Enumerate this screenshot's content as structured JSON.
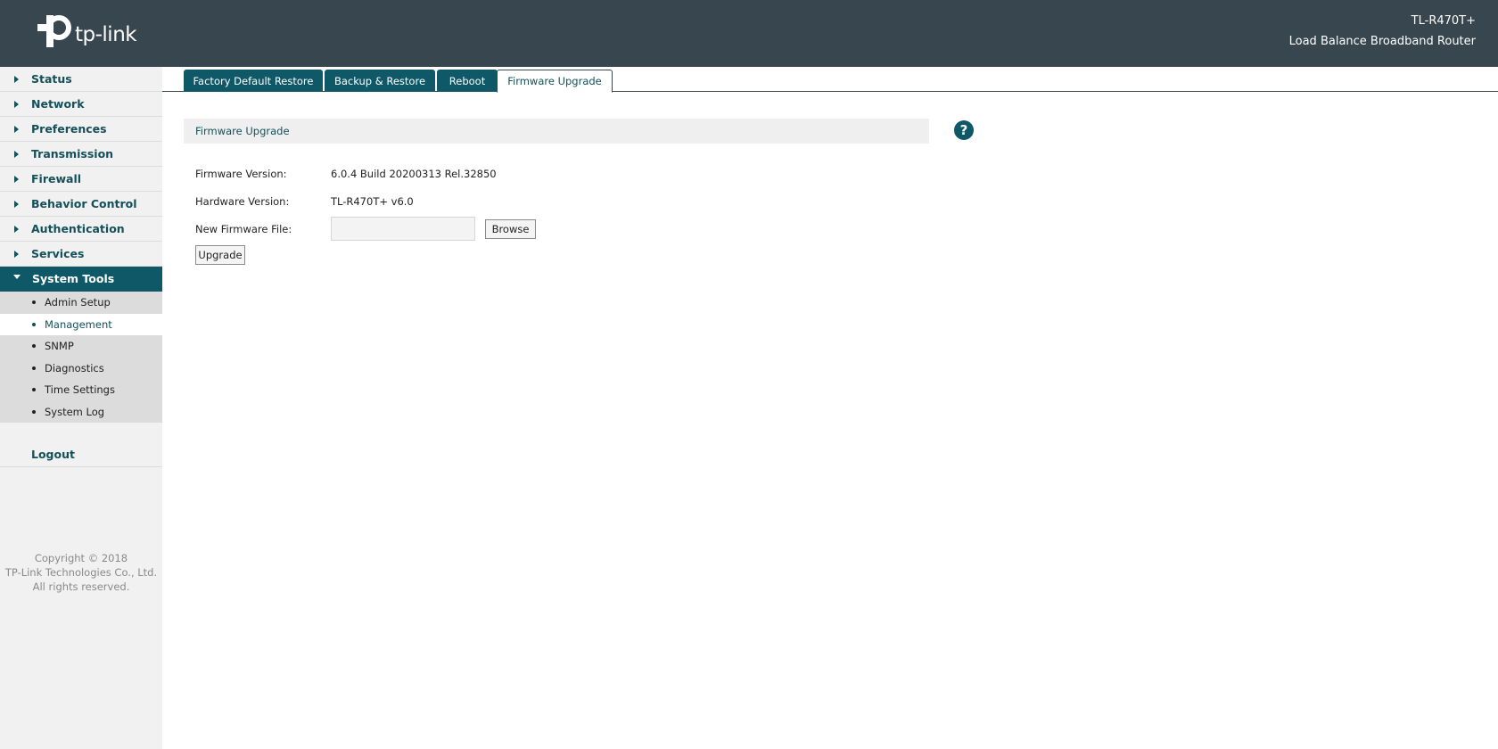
{
  "header": {
    "brand": "tp-link",
    "model": "TL-R470T+",
    "description": "Load Balance Broadband Router"
  },
  "sidebar": {
    "items": [
      {
        "label": "Status"
      },
      {
        "label": "Network"
      },
      {
        "label": "Preferences"
      },
      {
        "label": "Transmission"
      },
      {
        "label": "Firewall"
      },
      {
        "label": "Behavior Control"
      },
      {
        "label": "Authentication"
      },
      {
        "label": "Services"
      },
      {
        "label": "System Tools"
      }
    ],
    "subitems": [
      {
        "label": "Admin Setup"
      },
      {
        "label": "Management"
      },
      {
        "label": "SNMP"
      },
      {
        "label": "Diagnostics"
      },
      {
        "label": "Time Settings"
      },
      {
        "label": "System Log"
      }
    ],
    "logout": "Logout",
    "copyright": [
      "Copyright © 2018",
      "TP-Link Technologies Co., Ltd.",
      "All rights reserved."
    ]
  },
  "tabs": [
    {
      "label": "Factory Default Restore"
    },
    {
      "label": "Backup & Restore"
    },
    {
      "label": "Reboot"
    },
    {
      "label": "Firmware Upgrade"
    }
  ],
  "panel": {
    "title": "Firmware Upgrade",
    "help_icon": "?",
    "firmware_version_label": "Firmware Version:",
    "firmware_version": "6.0.4 Build 20200313 Rel.32850",
    "hardware_version_label": "Hardware Version:",
    "hardware_version": "TL-R470T+ v6.0",
    "new_file_label": "New Firmware File:",
    "browse_label": "Browse",
    "upgrade_label": "Upgrade"
  },
  "colors": {
    "header_bg": "#37464f",
    "accent": "#0f5867",
    "nav_text": "#14505a"
  }
}
